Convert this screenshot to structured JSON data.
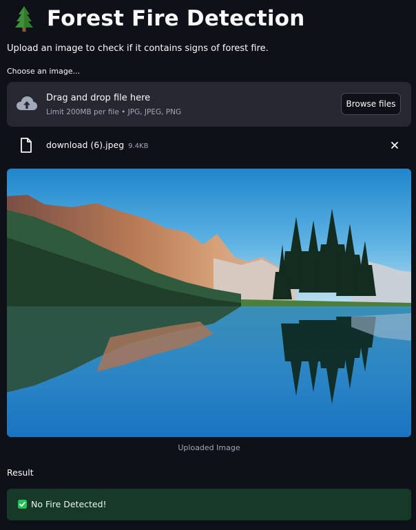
{
  "header": {
    "title": "Forest Fire Detection",
    "icon": "evergreen-tree-icon"
  },
  "description": "Upload an image to check if it contains signs of forest fire.",
  "uploader": {
    "label": "Choose an image...",
    "drop_title": "Drag and drop file here",
    "limit_text": "Limit 200MB per file • JPG, JPEG, PNG",
    "browse_label": "Browse files",
    "icon": "cloud-upload-icon"
  },
  "file": {
    "name": "download (6).jpeg",
    "size": "9.4KB",
    "icon": "file-icon",
    "remove_icon": "close-icon"
  },
  "image": {
    "caption": "Uploaded Image"
  },
  "result": {
    "label": "Result",
    "message": "No Fire Detected!",
    "status_icon": "check-box-icon",
    "colors": {
      "alert_bg": "#173928",
      "check": "#21c354"
    }
  },
  "colors": {
    "background": "#0e1117",
    "dropzone": "#262730",
    "text": "#fafafa",
    "muted": "#a3a8b8"
  }
}
